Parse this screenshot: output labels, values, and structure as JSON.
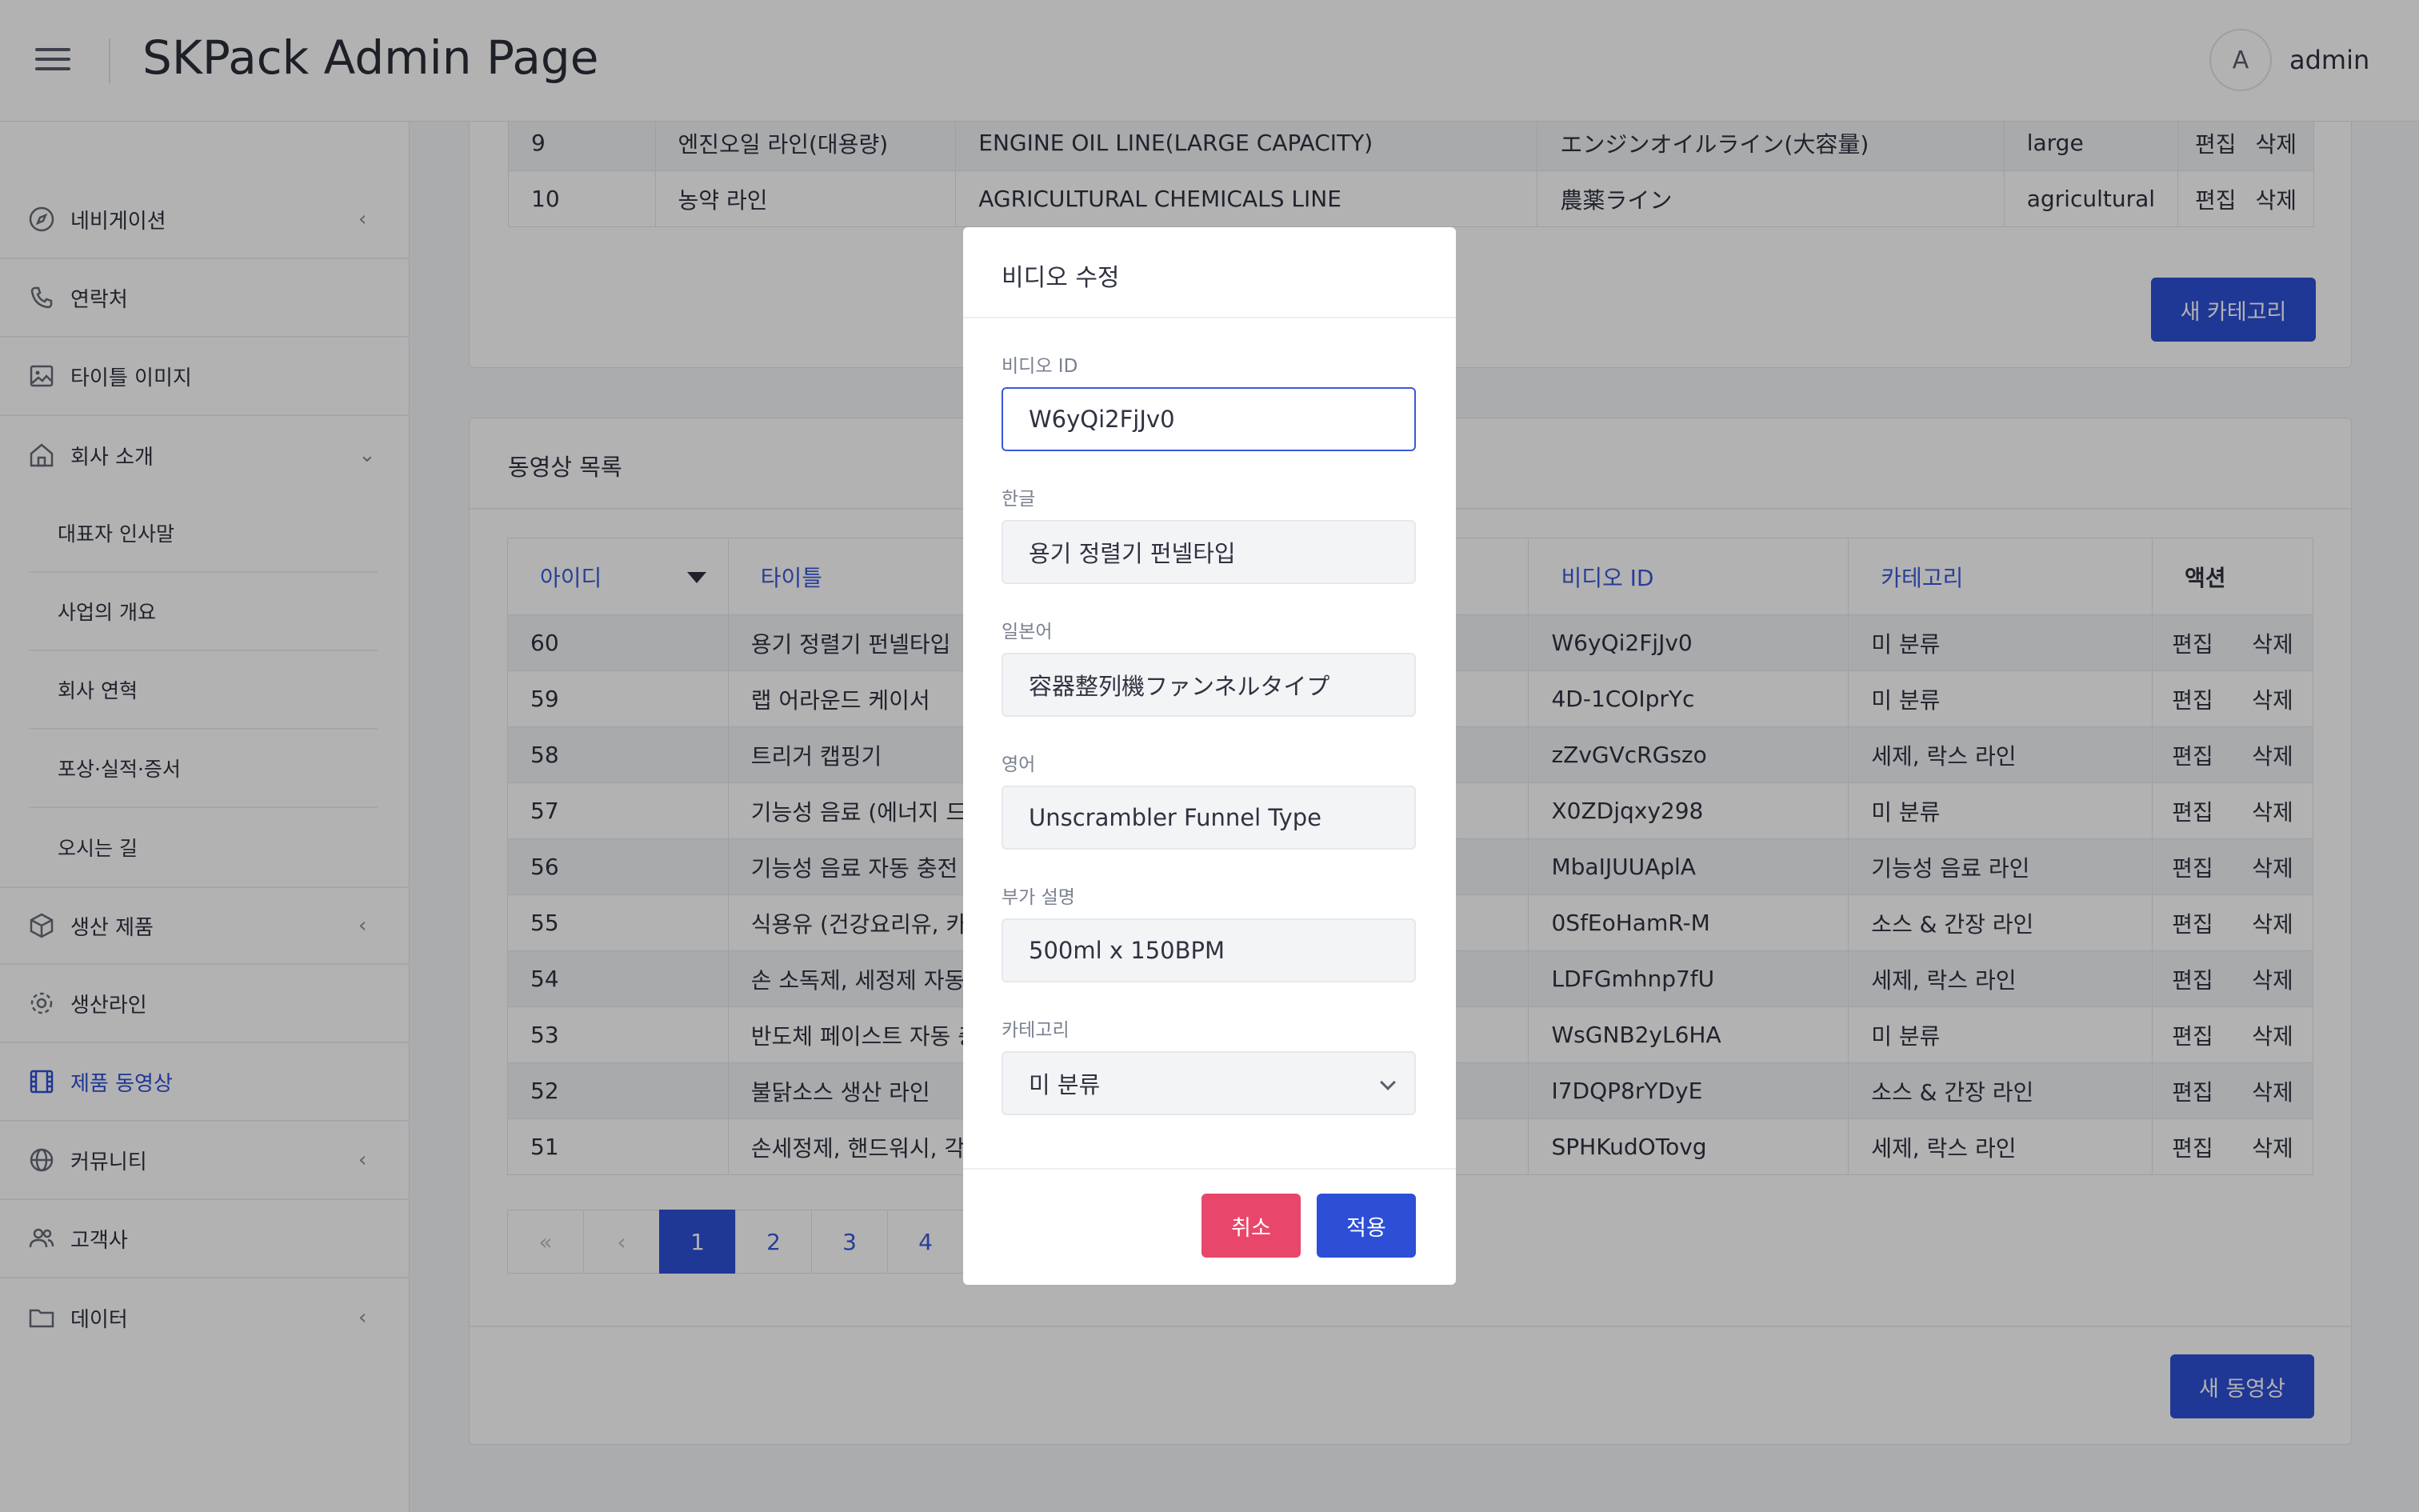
{
  "header": {
    "title": "SKPack Admin Page",
    "avatar_initial": "A",
    "user": "admin"
  },
  "sidebar": {
    "items": [
      {
        "label": "네비게이션",
        "icon": "compass-icon",
        "chevron": "‹"
      },
      {
        "label": "연락처",
        "icon": "phone-icon"
      },
      {
        "label": "타이틀 이미지",
        "icon": "image-icon"
      },
      {
        "label": "회사 소개",
        "icon": "home-icon",
        "chevron": "⌄"
      },
      {
        "label": "생산 제품",
        "icon": "box-icon",
        "chevron": "‹"
      },
      {
        "label": "생산라인",
        "icon": "gear-icon"
      },
      {
        "label": "제품 동영상",
        "icon": "film-icon"
      },
      {
        "label": "커뮤니티",
        "icon": "globe-icon",
        "chevron": "‹"
      },
      {
        "label": "고객사",
        "icon": "users-icon"
      },
      {
        "label": "데이터",
        "icon": "folder-icon",
        "chevron": "‹"
      }
    ],
    "sub_items": [
      "대표자 인사말",
      "사업의 개요",
      "회사 연혁",
      "포상·실적·증서",
      "오시는 길"
    ]
  },
  "category_table": {
    "rows": [
      {
        "id": "9",
        "ko": "엔진오일 라인(대용량)",
        "en": "ENGINE OIL LINE(LARGE CAPACITY)",
        "ja": "エンジンオイルライン(大容量)",
        "key": "large",
        "edit": "편집",
        "del": "삭제"
      },
      {
        "id": "10",
        "ko": "농약 라인",
        "en": "AGRICULTURAL CHEMICALS LINE",
        "ja": "農薬ライン",
        "key": "agricultural",
        "edit": "편집",
        "del": "삭제"
      }
    ],
    "new_button": "새 카테고리"
  },
  "video_section": {
    "title": "동영상 목록",
    "columns": {
      "id": "아이디",
      "title": "타이틀",
      "video_id": "비디오 ID",
      "category": "카테고리",
      "action": "액션"
    },
    "rows": [
      {
        "id": "60",
        "title": "용기 정렬기 펀넬타입",
        "vid": "W6yQi2FjJv0",
        "cat": "미 분류"
      },
      {
        "id": "59",
        "title": "랩 어라운드 케이서",
        "vid": "4D-1COIprYc",
        "cat": "미 분류"
      },
      {
        "id": "58",
        "title": "트리거 캡핑기",
        "vid": "zZvGVcRGszo",
        "cat": "세제, 락스 라인"
      },
      {
        "id": "57",
        "title": "기능성 음료 (에너지 드링",
        "vid": "X0ZDjqxy298",
        "cat": "미 분류"
      },
      {
        "id": "56",
        "title": "기능성 음료 자동 충전 포",
        "vid": "MbaIJUUAplA",
        "cat": "기능성 음료 라인"
      },
      {
        "id": "55",
        "title": "식용유 (건강요리유, 카놀",
        "vid": "0SfEoHamR-M",
        "cat": "소스 & 간장 라인"
      },
      {
        "id": "54",
        "title": "손 소독제, 세정제 자동 충",
        "vid": "LDFGmhnp7fU",
        "cat": "세제, 락스 라인"
      },
      {
        "id": "53",
        "title": "반도체 페이스트 자동 충",
        "vid": "WsGNB2yL6HA",
        "cat": "미 분류"
      },
      {
        "id": "52",
        "title": "불닭소스 생산 라인",
        "vid": "I7DQP8rYDyE",
        "cat": "소스 & 간장 라인"
      },
      {
        "id": "51",
        "title": "손세정제, 핸드워시, 각종",
        "vid": "SPHKudOTovg",
        "cat": "세제, 락스 라인"
      }
    ],
    "edit": "편집",
    "delete": "삭제",
    "pager": {
      "first": "«",
      "prev": "‹",
      "pages": [
        "1",
        "2",
        "3",
        "4"
      ],
      "current": "1"
    },
    "new_button": "새 동영상"
  },
  "modal": {
    "title": "비디오 수정",
    "fields": {
      "video_id": {
        "label": "비디오 ID",
        "value": "W6yQi2FjJv0"
      },
      "korean": {
        "label": "한글",
        "value": "용기 정렬기 펀넬타입"
      },
      "japanese": {
        "label": "일본어",
        "value": "容器整列機ファンネルタイプ"
      },
      "english": {
        "label": "영어",
        "value": "Unscrambler Funnel Type"
      },
      "extra": {
        "label": "부가 설명",
        "value": "500ml x 150BPM"
      },
      "category": {
        "label": "카테고리",
        "value": "미 분류"
      }
    },
    "cancel": "취소",
    "apply": "적용"
  },
  "colors": {
    "accent": "#2d4fd6",
    "danger": "#e8476b",
    "link": "#3a5ad8"
  }
}
